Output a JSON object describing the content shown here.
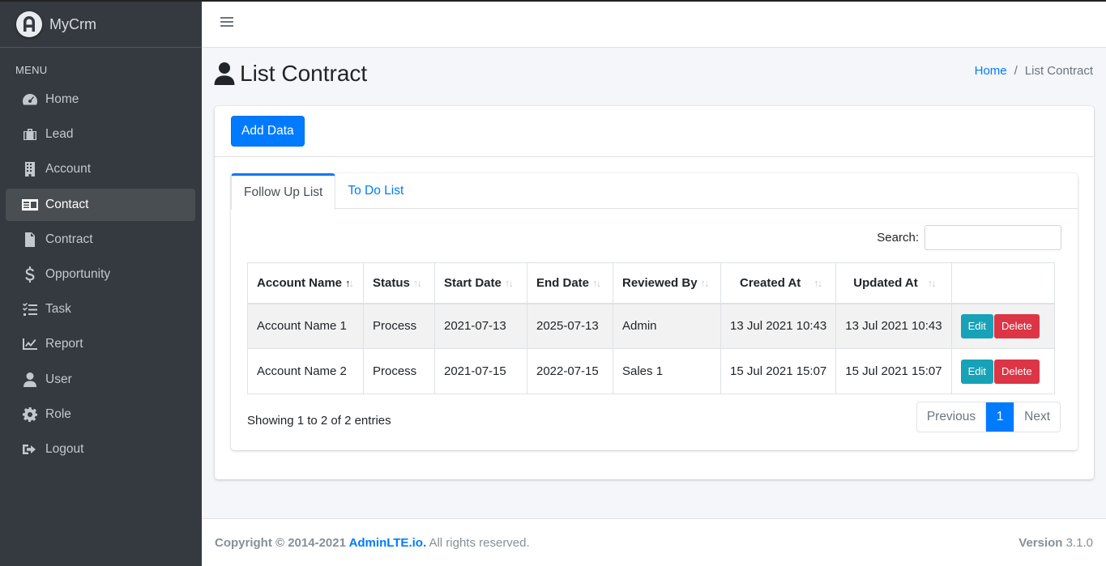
{
  "brand": {
    "name": "MyCrm",
    "logo_icon": "adminlte-logo-icon"
  },
  "sidebar": {
    "header": "MENU",
    "items": [
      {
        "label": "Home",
        "icon": "tachometer-icon",
        "active": false
      },
      {
        "label": "Lead",
        "icon": "briefcase-icon",
        "active": false
      },
      {
        "label": "Account",
        "icon": "building-icon",
        "active": false
      },
      {
        "label": "Contact",
        "icon": "id-card-icon",
        "active": true
      },
      {
        "label": "Contract",
        "icon": "file-contract-icon",
        "active": false
      },
      {
        "label": "Opportunity",
        "icon": "dollar-icon",
        "active": false
      },
      {
        "label": "Task",
        "icon": "tasks-icon",
        "active": false
      },
      {
        "label": "Report",
        "icon": "chart-line-icon",
        "active": false
      },
      {
        "label": "User",
        "icon": "user-icon",
        "active": false
      },
      {
        "label": "Role",
        "icon": "gear-icon",
        "active": false
      },
      {
        "label": "Logout",
        "icon": "sign-out-icon",
        "active": false
      }
    ]
  },
  "header": {
    "title": "List Contract",
    "breadcrumb": {
      "home": "Home",
      "sep": "/",
      "current": "List Contract"
    }
  },
  "toolbar": {
    "add_label": "Add Data"
  },
  "tabs": [
    {
      "label": "Follow Up List",
      "active": true
    },
    {
      "label": "To Do List",
      "active": false
    }
  ],
  "search": {
    "label": "Search:",
    "value": "",
    "placeholder": ""
  },
  "table": {
    "columns": [
      "Account Name",
      "Status",
      "Start Date",
      "End Date",
      "Reviewed By",
      "Created At",
      "Updated At",
      ""
    ],
    "rows": [
      {
        "account": "Account Name 1",
        "status": "Process",
        "start": "2021-07-13",
        "end": "2025-07-13",
        "reviewed": "Admin",
        "created": "13 Jul 2021 10:43",
        "updated": "13 Jul 2021 10:43"
      },
      {
        "account": "Account Name 2",
        "status": "Process",
        "start": "2021-07-15",
        "end": "2022-07-15",
        "reviewed": "Sales 1",
        "created": "15 Jul 2021 15:07",
        "updated": "15 Jul 2021 15:07"
      }
    ],
    "edit_label": "Edit",
    "delete_label": "Delete"
  },
  "pagination": {
    "info": "Showing 1 to 2 of 2 entries",
    "previous": "Previous",
    "current": "1",
    "next": "Next"
  },
  "footer": {
    "copyright_prefix": "Copyright © 2014-2021 ",
    "link": "AdminLTE.io.",
    "suffix": " All rights reserved.",
    "version_label": "Version",
    "version": " 3.1.0"
  },
  "colors": {
    "primary": "#007bff",
    "info": "#17a2b8",
    "danger": "#dc3545",
    "sidebar": "#343a40"
  }
}
